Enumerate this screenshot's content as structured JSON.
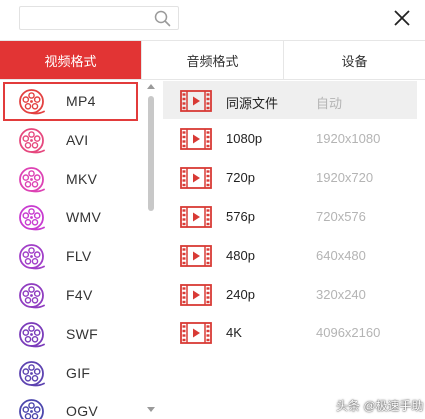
{
  "search": {
    "value": "",
    "placeholder": ""
  },
  "tabs": [
    {
      "label": "视频格式",
      "active": true
    },
    {
      "label": "音频格式",
      "active": false
    },
    {
      "label": "设备",
      "active": false
    }
  ],
  "formats": [
    {
      "label": "MP4",
      "color": "#e34141",
      "selected": true
    },
    {
      "label": "AVI",
      "color": "#e6487e",
      "selected": false
    },
    {
      "label": "MKV",
      "color": "#dd42b4",
      "selected": false
    },
    {
      "label": "WMV",
      "color": "#c83bd0",
      "selected": false
    },
    {
      "label": "FLV",
      "color": "#a13ec8",
      "selected": false
    },
    {
      "label": "F4V",
      "color": "#8f3cc0",
      "selected": false
    },
    {
      "label": "SWF",
      "color": "#7a3bba",
      "selected": false
    },
    {
      "label": "GIF",
      "color": "#5d43b1",
      "selected": false
    },
    {
      "label": "OGV",
      "color": "#4c47ad",
      "selected": false
    }
  ],
  "resolutions": [
    {
      "name": "同源文件",
      "dim": "自动",
      "highlight": true
    },
    {
      "name": "1080p",
      "dim": "1920x1080",
      "highlight": false
    },
    {
      "name": "720p",
      "dim": "1920x720",
      "highlight": false
    },
    {
      "name": "576p",
      "dim": "720x576",
      "highlight": false
    },
    {
      "name": "480p",
      "dim": "640x480",
      "highlight": false
    },
    {
      "name": "240p",
      "dim": "320x240",
      "highlight": false
    },
    {
      "name": "4K",
      "dim": "4096x2160",
      "highlight": false
    }
  ],
  "colors": {
    "accent": "#e23434",
    "film_icon": "#d83a35"
  },
  "watermark": "头条 @极速手助"
}
